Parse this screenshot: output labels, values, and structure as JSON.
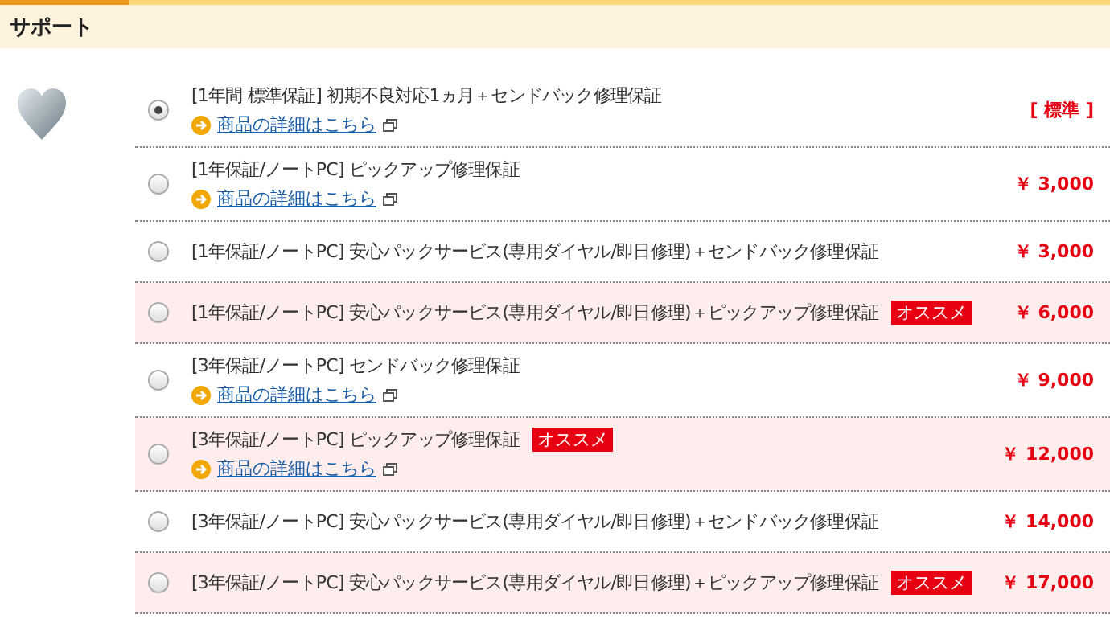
{
  "section": {
    "title": "サポート"
  },
  "options": [
    {
      "label": "[1年間 標準保証] 初期不良対応1ヵ月＋センドバック修理保証",
      "link": "商品の詳細はこちら",
      "price": "[ 標準 ]",
      "selected": true,
      "recommended": false
    },
    {
      "label": "[1年保証/ノートPC] ピックアップ修理保証",
      "link": "商品の詳細はこちら",
      "price": "￥ 3,000",
      "selected": false,
      "recommended": false
    },
    {
      "label": "[1年保証/ノートPC] 安心パックサービス(専用ダイヤル/即日修理)＋センドバック修理保証",
      "price": "￥ 3,000",
      "selected": false,
      "recommended": false
    },
    {
      "label": "[1年保証/ノートPC] 安心パックサービス(専用ダイヤル/即日修理)＋ピックアップ修理保証",
      "badge": "オススメ",
      "price": "￥ 6,000",
      "selected": false,
      "recommended": true
    },
    {
      "label": "[3年保証/ノートPC] センドバック修理保証",
      "link": "商品の詳細はこちら",
      "price": "￥ 9,000",
      "selected": false,
      "recommended": false
    },
    {
      "label": "[3年保証/ノートPC] ピックアップ修理保証",
      "link": "商品の詳細はこちら",
      "badge": "オススメ",
      "price": "￥ 12,000",
      "selected": false,
      "recommended": true
    },
    {
      "label": "[3年保証/ノートPC] 安心パックサービス(専用ダイヤル/即日修理)＋センドバック修理保証",
      "price": "￥ 14,000",
      "selected": false,
      "recommended": false
    },
    {
      "label": "[3年保証/ノートPC] 安心パックサービス(専用ダイヤル/即日修理)＋ピックアップ修理保証",
      "badge": "オススメ",
      "price": "￥ 17,000",
      "selected": false,
      "recommended": true
    }
  ]
}
